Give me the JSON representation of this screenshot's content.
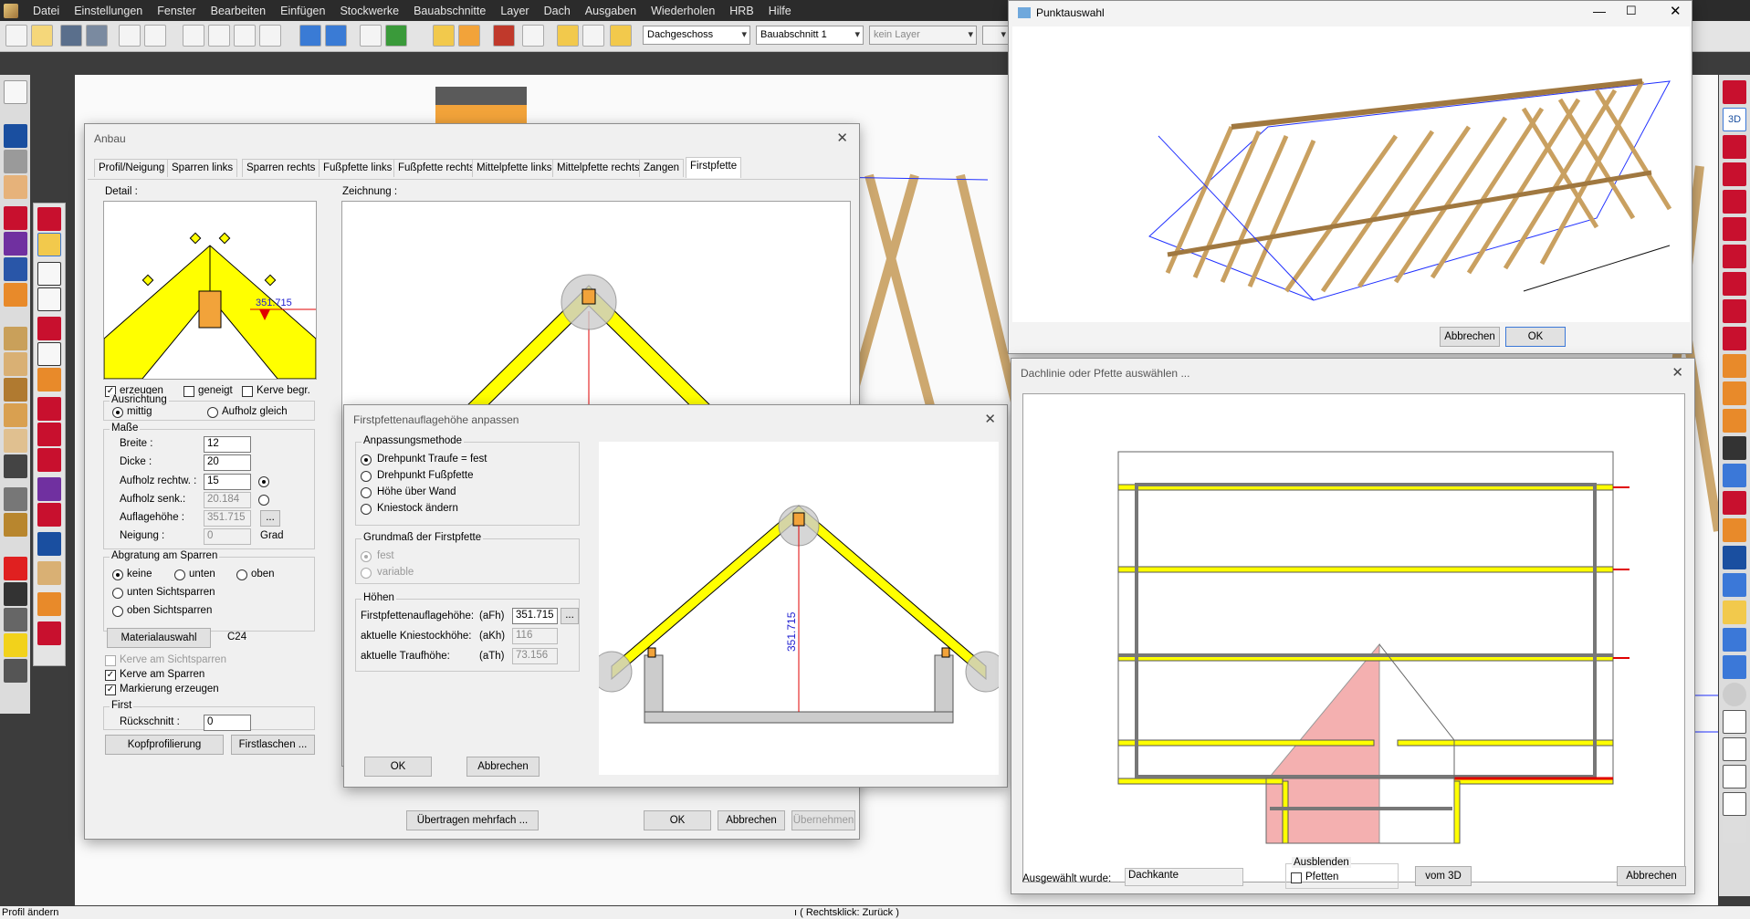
{
  "menu": [
    "Datei",
    "Einstellungen",
    "Fenster",
    "Bearbeiten",
    "Einfügen",
    "Stockwerke",
    "Bauabschnitte",
    "Layer",
    "Dach",
    "Ausgaben",
    "Wiederholen",
    "HRB",
    "Hilfe"
  ],
  "toolbar": {
    "floor": "Dachgeschoss",
    "section": "Bauabschnitt 1",
    "layer": "kein Layer"
  },
  "status": {
    "left": "Profil ändern",
    "center": "ı ( Rechtsklick: Zurück )"
  },
  "anbau": {
    "title": "Anbau",
    "tabs": [
      "Profil/Neigung",
      "Sparren links",
      "Sparren rechts",
      "Fußpfette links",
      "Fußpfette rechts",
      "Mittelpfette links",
      "Mittelpfette rechts",
      "Zangen",
      "Firstpfette"
    ],
    "detail_label": "Detail :",
    "drawing_label": "Zeichnung :",
    "detail_value": "351.715",
    "cb_erzeugen": "erzeugen",
    "cb_geneigt": "geneigt",
    "cb_kerve": "Kerve begr.",
    "ausrichtung": {
      "title": "Ausrichtung",
      "mittig": "mittig",
      "aufholz": "Aufholz gleich"
    },
    "masse": {
      "title": "Maße",
      "breite_l": "Breite :",
      "breite": "12",
      "dicke_l": "Dicke :",
      "dicke": "20",
      "aufr_l": "Aufholz rechtw. :",
      "aufr": "15",
      "aufs_l": "Aufholz senk.:",
      "aufs": "20.184",
      "aufl_l": "Auflagehöhe :",
      "aufl": "351.715",
      "neig_l": "Neigung :",
      "neig": "0",
      "grad": "Grad",
      "dots": "..."
    },
    "abgratung": {
      "title": "Abgratung am Sparren",
      "keine": "keine",
      "unten": "unten",
      "oben": "oben",
      "unten_s": "unten Sichtsparren",
      "oben_s": "oben Sichtsparren"
    },
    "material_btn": "Materialauswahl",
    "material": "C24",
    "kerve_sicht": "Kerve am Sichtsparren",
    "kerve_sparren": "Kerve am Sparren",
    "markierung": "Markierung erzeugen",
    "first": {
      "title": "First",
      "rueck_l": "Rückschnitt :",
      "rueck": "0",
      "kopf_btn": "Kopfprofilierung",
      "laschen_btn": "Firstlaschen ..."
    },
    "uebertragen": "Übertragen mehrfach ...",
    "ok": "OK",
    "abbrechen": "Abbrechen",
    "uebernehmen": "Übernehmen"
  },
  "firstpf": {
    "title": "Firstpfettenauflagehöhe anpassen",
    "methode": {
      "title": "Anpassungsmethode",
      "o1": "Drehpunkt Traufe = fest",
      "o2": "Drehpunkt Fußpfette",
      "o3": "Höhe über Wand",
      "o4": "Kniestock ändern"
    },
    "grund": {
      "title": "Grundmaß der Firstpfette",
      "fest": "fest",
      "variable": "variable"
    },
    "hoehen": {
      "title": "Höhen",
      "fh_l": "Firstpfettenauflagehöhe:",
      "fh_a": "(aFh)",
      "fh": "351.715",
      "kh_l": "aktuelle Kniestockhöhe:",
      "kh_a": "(aKh)",
      "kh": "116",
      "th_l": "aktuelle Traufhöhe:",
      "th_a": "(aTh)",
      "th": "73.156",
      "dots": "..."
    },
    "dim": "351.715",
    "ok": "OK",
    "abbrechen": "Abbrechen"
  },
  "punkt": {
    "title": "Punktauswahl",
    "abbrechen": "Abbrechen",
    "ok": "OK"
  },
  "dachlinie": {
    "title": "Dachlinie oder Pfette auswählen ...",
    "ausgewaehlt_l": "Ausgewählt wurde:",
    "ausgewaehlt": "Dachkante",
    "ausblenden": "Ausblenden",
    "pfetten": "Pfetten",
    "vom3d": "vom 3D",
    "abbrechen": "Abbrechen"
  },
  "colors": {
    "yellow": "#ffff00",
    "accent": "#3b78d8",
    "red": "#e00000",
    "wood": "#d9b074"
  }
}
